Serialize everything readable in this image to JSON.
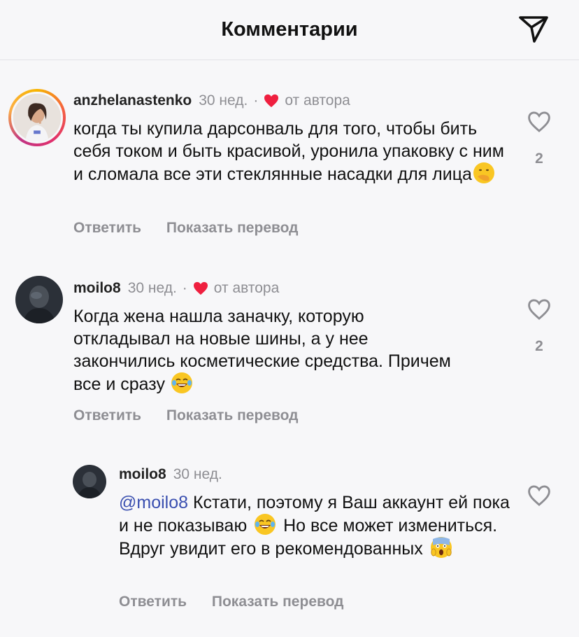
{
  "header": {
    "title": "Комментарии",
    "share_icon": "paper-plane-icon"
  },
  "comments": [
    {
      "username": "anzhelanastenko",
      "time": "30 нед.",
      "separator": "·",
      "liked_by_author": "от автора",
      "text": "когда ты купила дарсонваль для того, чтобы бить себя током и быть красивой, уронила упаковку с ним и сломала все эти стеклянные насадки для лица",
      "reply_label": "Ответить",
      "translate_label": "Показать перевод",
      "likes": "2"
    },
    {
      "username": "moilo8",
      "time": "30 нед.",
      "separator": "·",
      "liked_by_author": "от автора",
      "text": "Когда жена нашла заначку, которую откладывал на новые шины, а у нее закончились косметические средства. Причем все и сразу",
      "reply_label": "Ответить",
      "translate_label": "Показать перевод",
      "likes": "2"
    },
    {
      "username": "moilo8",
      "time": "30 нед.",
      "mention": "@moilo8",
      "text_a": "Кстати, поэтому я Ваш аккаунт ей пока и не показываю",
      "text_b": "Но все может измениться. Вдруг увидит его в рекомендованных",
      "reply_label": "Ответить",
      "translate_label": "Показать перевод"
    }
  ],
  "colors": {
    "heart_red": "#ef1f3f",
    "mention": "#3a4fb0",
    "muted": "#8e8e93"
  }
}
